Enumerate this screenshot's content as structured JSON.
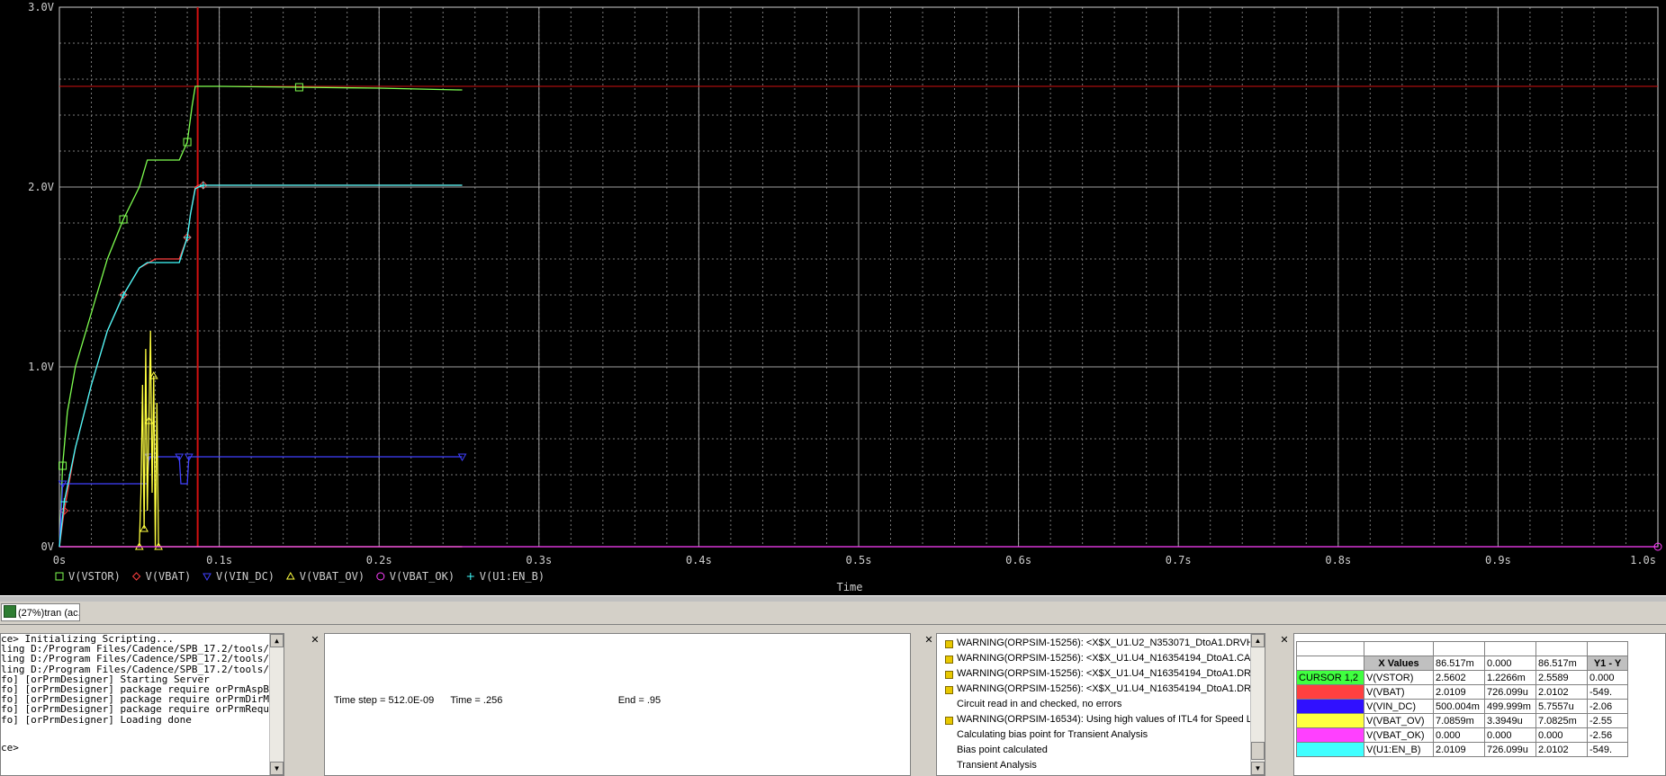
{
  "plot": {
    "y_ticks": [
      "3.0V",
      "2.0V",
      "1.0V",
      "0V"
    ],
    "x_ticks": [
      "0s",
      "0.1s",
      "0.2s",
      "0.3s",
      "0.4s",
      "0.5s",
      "0.6s",
      "0.7s",
      "0.8s",
      "0.9s",
      "1.0s"
    ],
    "x_label": "Time",
    "legend": [
      {
        "marker": "□",
        "label": "V(VSTOR)",
        "color": "#7fff50"
      },
      {
        "marker": "◇",
        "label": "V(VBAT)",
        "color": "#ff4040"
      },
      {
        "marker": "▽",
        "label": "V(VIN_DC)",
        "color": "#4040ff"
      },
      {
        "marker": "△",
        "label": "V(VBAT_OV)",
        "color": "#ffff40"
      },
      {
        "marker": "○",
        "label": "V(VBAT_OK)",
        "color": "#ff40ff"
      },
      {
        "marker": "+",
        "label": "V(U1:EN_B)",
        "color": "#40ffff"
      }
    ],
    "cursor_color": "#d01010"
  },
  "chart_data": {
    "type": "line",
    "xlabel": "Time",
    "ylabel": "",
    "xlim": [
      0,
      1.0
    ],
    "ylim": [
      0,
      3.0
    ],
    "grid": true,
    "legend_position": "bottom",
    "cursor_x": 0.0865,
    "cursor_hline": 2.56,
    "series": [
      {
        "name": "V(VSTOR)",
        "color": "#7fff50",
        "x": [
          0,
          0.002,
          0.005,
          0.01,
          0.02,
          0.03,
          0.04,
          0.05,
          0.055,
          0.07,
          0.075,
          0.08,
          0.083,
          0.085,
          0.087,
          0.1,
          0.15,
          0.2,
          0.25,
          0.252
        ],
        "y": [
          0,
          0.45,
          0.75,
          1.0,
          1.3,
          1.6,
          1.82,
          2.0,
          2.15,
          2.15,
          2.15,
          2.25,
          2.45,
          2.56,
          2.56,
          2.56,
          2.555,
          2.55,
          2.54,
          2.54
        ]
      },
      {
        "name": "V(VBAT)",
        "color": "#ff4040",
        "x": [
          0,
          0.003,
          0.01,
          0.02,
          0.03,
          0.04,
          0.05,
          0.06,
          0.075,
          0.08,
          0.082,
          0.085,
          0.087,
          0.09,
          0.15,
          0.252
        ],
        "y": [
          0,
          0.2,
          0.55,
          0.9,
          1.2,
          1.4,
          1.55,
          1.6,
          1.6,
          1.72,
          1.85,
          2.0,
          2.01,
          2.01,
          2.01,
          2.01
        ]
      },
      {
        "name": "V(VIN_DC)",
        "color": "#4040ff",
        "x": [
          0,
          0.002,
          0.05,
          0.055,
          0.056,
          0.058,
          0.06,
          0.075,
          0.076,
          0.08,
          0.081,
          0.083,
          0.085,
          0.252
        ],
        "y": [
          0,
          0.35,
          0.35,
          0.35,
          0.5,
          0.5,
          0.5,
          0.5,
          0.35,
          0.35,
          0.5,
          0.5,
          0.5,
          0.5
        ]
      },
      {
        "name": "V(VBAT_OV)",
        "color": "#ffff40",
        "x": [
          0,
          0.05,
          0.051,
          0.052,
          0.053,
          0.054,
          0.055,
          0.056,
          0.057,
          0.058,
          0.059,
          0.06,
          0.061,
          0.062,
          0.252
        ],
        "y": [
          0,
          0,
          0.3,
          0.9,
          0.1,
          1.1,
          0.2,
          0.7,
          1.2,
          0.3,
          0.95,
          0.0,
          0.8,
          0,
          0
        ]
      },
      {
        "name": "V(VBAT_OK)",
        "color": "#ff40ff",
        "x": [
          0,
          1.0
        ],
        "y": [
          0,
          0
        ]
      },
      {
        "name": "V(U1:EN_B)",
        "color": "#40ffff",
        "x": [
          0,
          0.003,
          0.01,
          0.02,
          0.03,
          0.04,
          0.05,
          0.055,
          0.075,
          0.08,
          0.082,
          0.085,
          0.087,
          0.09,
          0.15,
          0.252
        ],
        "y": [
          0,
          0.25,
          0.55,
          0.9,
          1.2,
          1.4,
          1.55,
          1.58,
          1.58,
          1.72,
          1.85,
          1.99,
          2.0,
          2.01,
          2.01,
          2.01
        ]
      }
    ]
  },
  "tabs": {
    "active_label": "(27%)tran (ac..."
  },
  "console": {
    "lines": [
      "ce> Initializing Scripting...",
      "ling D:/Program Files/Cadence/SPB_17.2/tools/",
      "ling D:/Program Files/Cadence/SPB_17.2/tools/",
      "ling D:/Program Files/Cadence/SPB_17.2/tools/",
      "fo] [orPrmDesigner] Starting Server",
      "fo] [orPrmDesigner] package require orPrmAspB",
      "fo] [orPrmDesigner] package require orPrmDirM",
      "fo] [orPrmDesigner] package require orPrmRequ",
      "fo] [orPrmDesigner] Loading done"
    ],
    "prompt": "ce>"
  },
  "sim_status": {
    "time_step_label": "Time step =",
    "time_step": "512.0E-09",
    "time_label": "Time =",
    "time": ".256",
    "end_label": "End =",
    "end": ".95"
  },
  "messages": [
    {
      "warn": true,
      "text": "WARNING(ORPSIM-15256): <X$X_U1.U2_N353071_DtoA1.DRVH:"
    },
    {
      "warn": true,
      "text": "WARNING(ORPSIM-15256): <X$X_U1.U4_N16354194_DtoA1.CAP"
    },
    {
      "warn": true,
      "text": "WARNING(ORPSIM-15256): <X$X_U1.U4_N16354194_DtoA1.DRV"
    },
    {
      "warn": true,
      "text": "WARNING(ORPSIM-15256): <X$X_U1.U4_N16354194_DtoA1.DRV"
    },
    {
      "warn": false,
      "text": "Circuit read in and checked, no errors"
    },
    {
      "warn": true,
      "text": "WARNING(ORPSIM-16534): Using high values of ITL4 for Speed Le"
    },
    {
      "warn": false,
      "text": "Calculating bias point for Transient Analysis"
    },
    {
      "warn": false,
      "text": "Bias point calculated"
    },
    {
      "warn": false,
      "text": "Transient Analysis"
    }
  ],
  "probe": {
    "header": [
      "",
      "X Values",
      "86.517m",
      "0.000",
      "86.517m",
      "Y1 - Y"
    ],
    "cursor_label": "CURSOR 1,2",
    "rows": [
      {
        "swatch": "#40ff40",
        "swatch_text": "CURSOR 1,2",
        "name": "V(VSTOR)",
        "v1": "2.5602",
        "v2": "1.2266m",
        "v3": "2.5589",
        "v4": "0.000"
      },
      {
        "swatch": "#ff4040",
        "swatch_text": "",
        "name": "V(VBAT)",
        "v1": "2.0109",
        "v2": "726.099u",
        "v3": "2.0102",
        "v4": "-549."
      },
      {
        "swatch": "#3010ff",
        "swatch_text": "",
        "name": "V(VIN_DC)",
        "v1": "500.004m",
        "v2": "499.999m",
        "v3": "5.7557u",
        "v4": "-2.06"
      },
      {
        "swatch": "#ffff40",
        "swatch_text": "",
        "name": "V(VBAT_OV)",
        "v1": "7.0859m",
        "v2": "3.3949u",
        "v3": "7.0825m",
        "v4": "-2.55"
      },
      {
        "swatch": "#ff40ff",
        "swatch_text": "",
        "name": "V(VBAT_OK)",
        "v1": "0.000",
        "v2": "0.000",
        "v3": "0.000",
        "v4": "-2.56"
      },
      {
        "swatch": "#40ffff",
        "swatch_text": "",
        "name": "V(U1:EN_B)",
        "v1": "2.0109",
        "v2": "726.099u",
        "v3": "2.0102",
        "v4": "-549."
      }
    ]
  }
}
